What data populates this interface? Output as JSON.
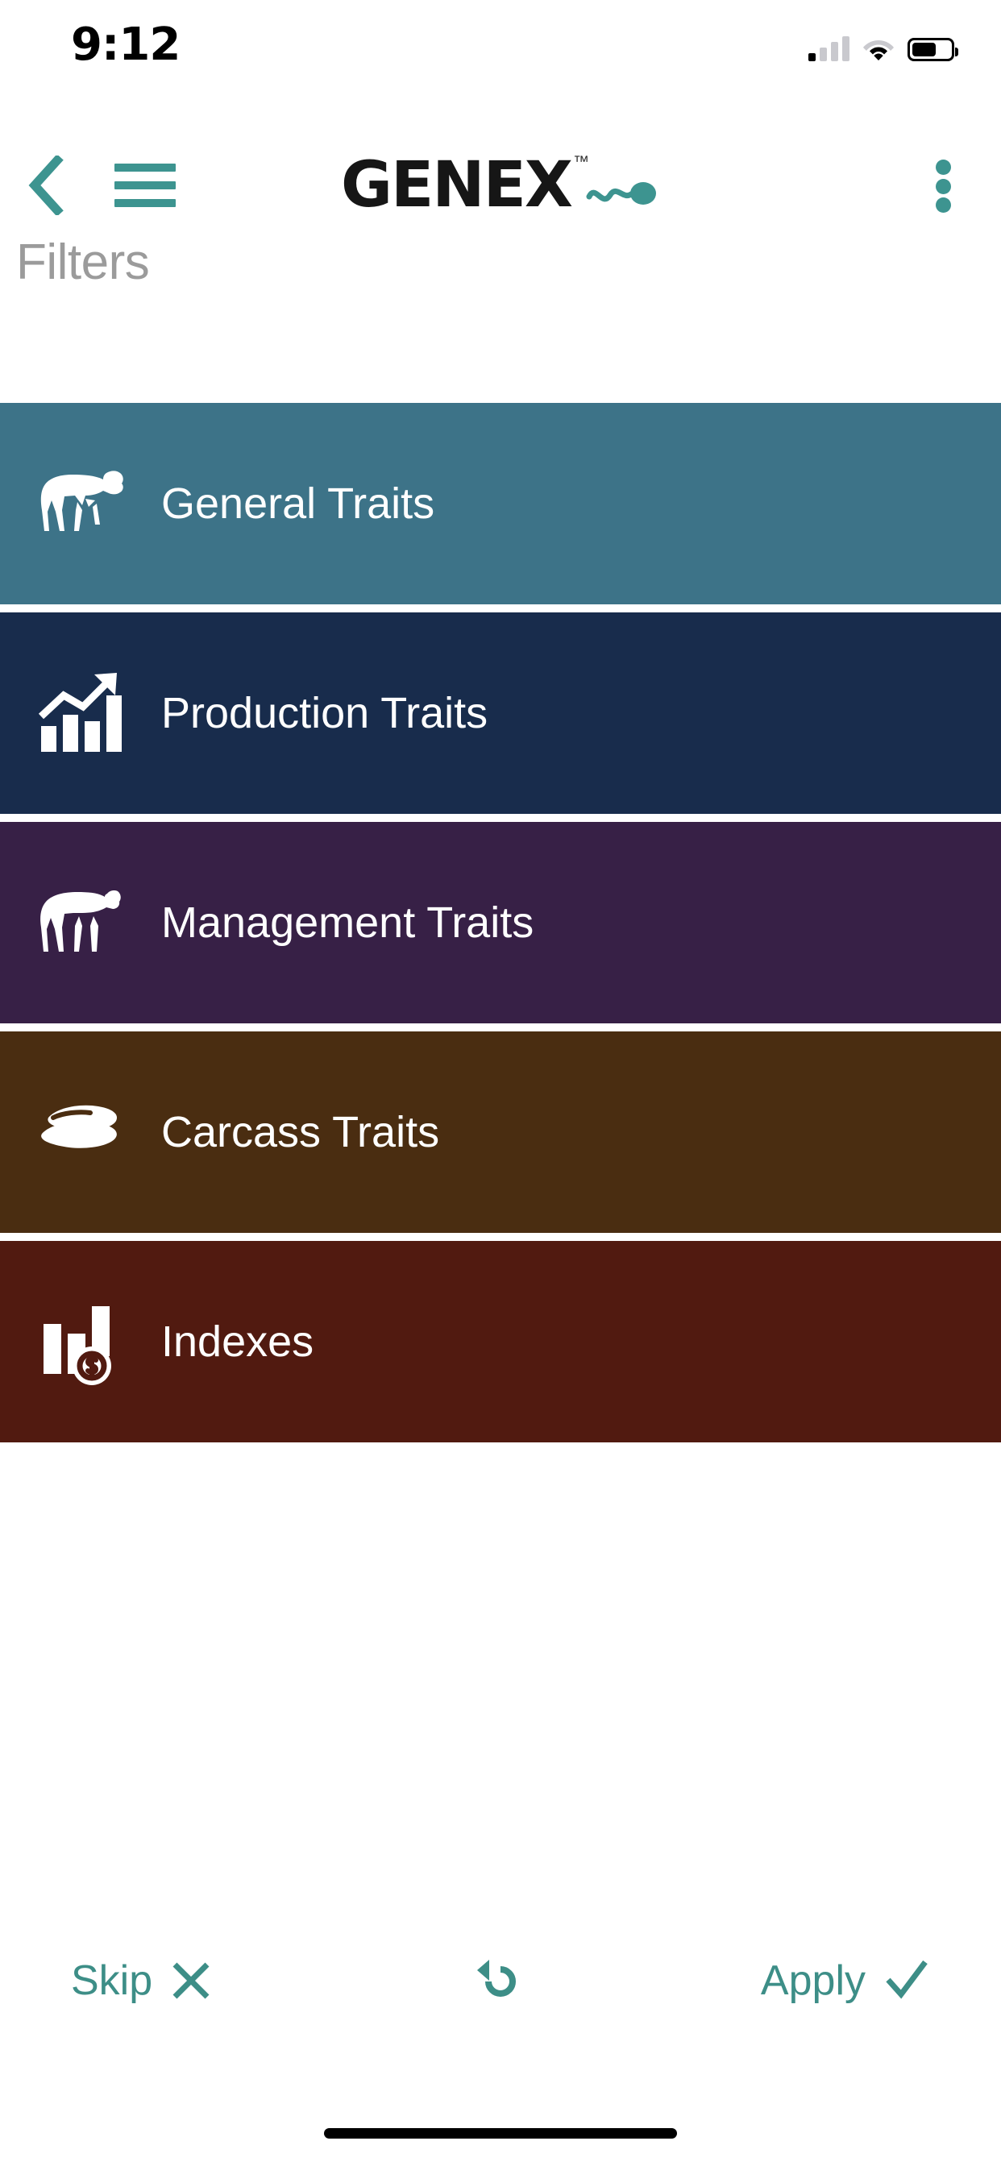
{
  "status_bar": {
    "time": "9:12",
    "cellular_icon": "cellular-signal-icon",
    "cellular_bars_total": 4,
    "cellular_bars_filled": 1,
    "wifi_icon": "wifi-icon",
    "battery_icon": "battery-icon",
    "battery_level_percent": 50
  },
  "header": {
    "back_icon": "chevron-left-icon",
    "menu_icon": "hamburger-menu-icon",
    "logo_text": "GENEX",
    "logo_trademark": "™",
    "logo_swoosh_icon": "sperm-swoosh-icon",
    "overflow_icon": "kebab-menu-icon",
    "accent_color": "#3d9490"
  },
  "page": {
    "title": "Filters",
    "title_color": "#9b9b9b"
  },
  "filters": {
    "items": [
      {
        "label": "General Traits",
        "icon": "bull-icon",
        "bg_color": "#3d7388",
        "text_color": "#ffffff"
      },
      {
        "label": "Production Traits",
        "icon": "bar-chart-trend-up-icon",
        "bg_color": "#182c4c",
        "text_color": "#ffffff"
      },
      {
        "label": "Management Traits",
        "icon": "cow-icon",
        "bg_color": "#372046",
        "text_color": "#ffffff"
      },
      {
        "label": "Carcass Traits",
        "icon": "steak-cut-icon",
        "bg_color": "#4a2d11",
        "text_color": "#ffffff"
      },
      {
        "label": "Indexes",
        "icon": "bar-chart-dollar-icon",
        "bg_color": "#511a10",
        "text_color": "#ffffff"
      }
    ]
  },
  "action_bar": {
    "skip_label": "Skip",
    "skip_icon": "close-x-icon",
    "reset_icon": "rotate-ccw-reset-icon",
    "apply_label": "Apply",
    "apply_icon": "check-icon",
    "accent_color": "#3d8e87"
  },
  "home_indicator": {
    "icon": "home-indicator-bar"
  }
}
